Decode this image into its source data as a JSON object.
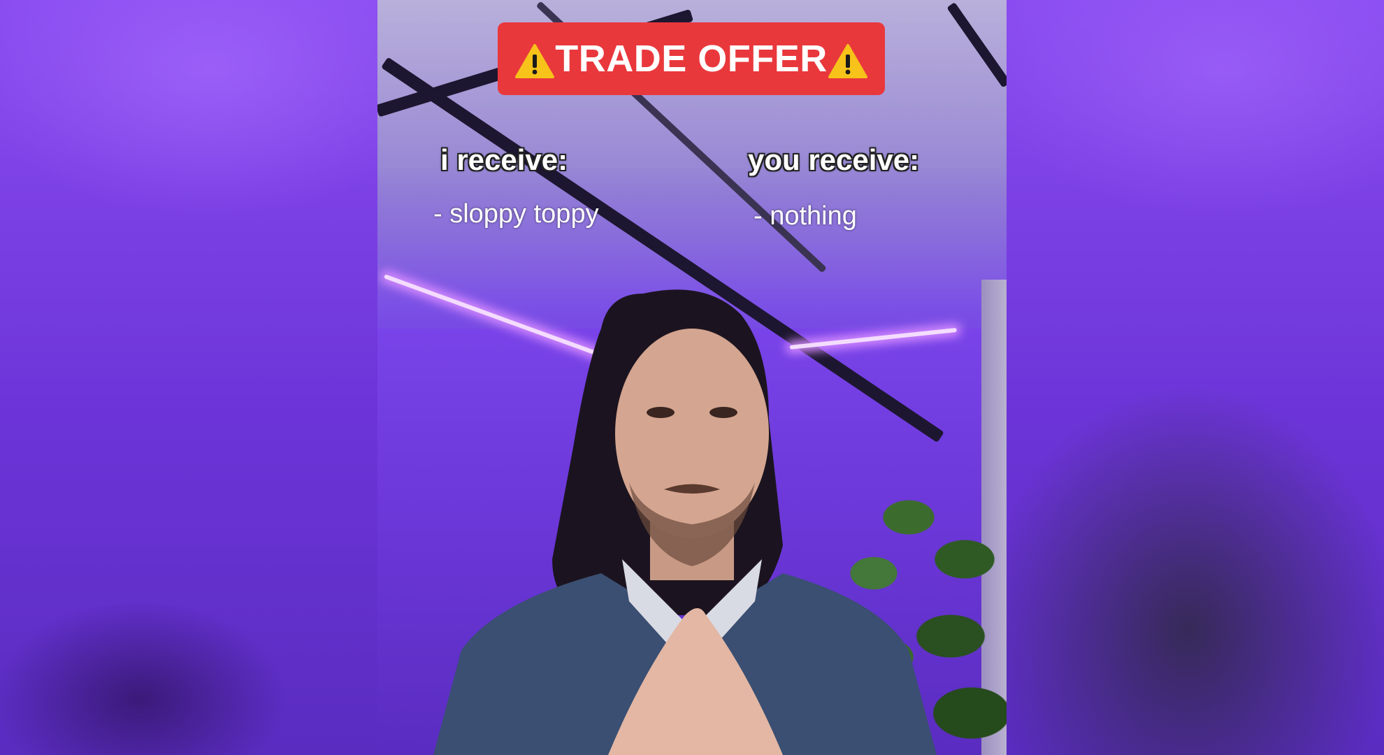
{
  "banner": {
    "title": "TRADE OFFER",
    "icon": "warning-icon",
    "background": "#e9383c",
    "text_color": "#ffffff"
  },
  "left_column": {
    "heading": "i receive:",
    "item": "- sloppy toppy"
  },
  "right_column": {
    "heading": "you receive:",
    "item": "- nothing"
  },
  "colors": {
    "ambient_light": "#7a3fe0",
    "led_glow": "#d78cff"
  }
}
